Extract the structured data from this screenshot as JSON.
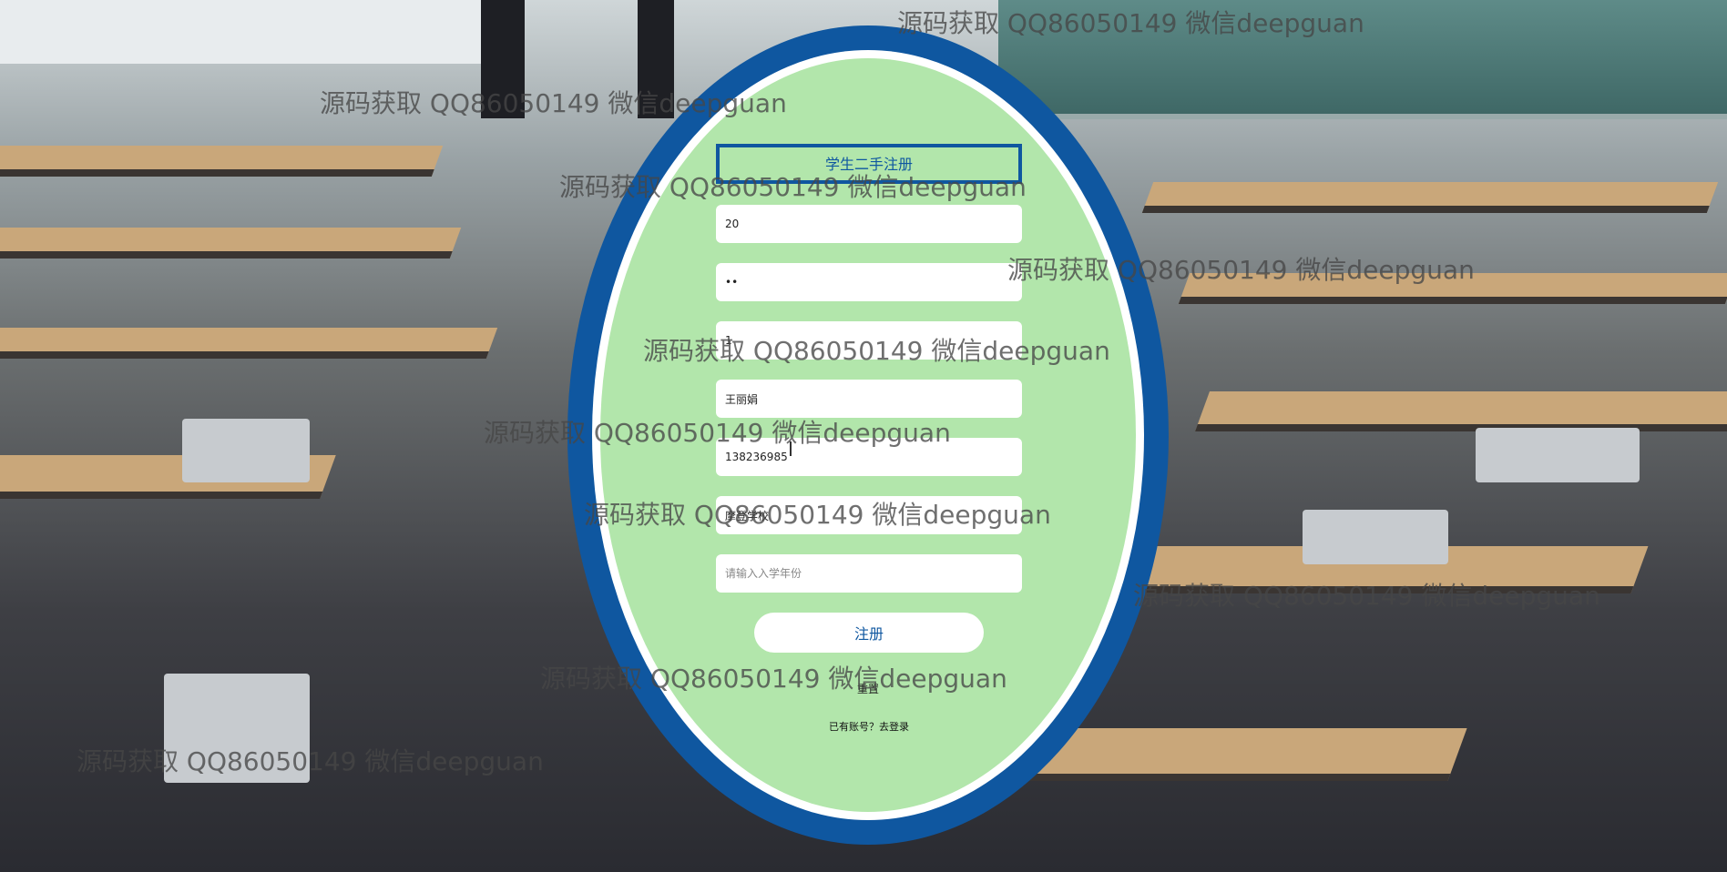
{
  "form": {
    "title": "学生二手注册",
    "fields": [
      {
        "name": "username",
        "value": "20",
        "placeholder": ""
      },
      {
        "name": "password",
        "value": "••",
        "placeholder": ""
      },
      {
        "name": "confirm",
        "value": "1",
        "placeholder": ""
      },
      {
        "name": "realname",
        "value": "王丽娟",
        "placeholder": ""
      },
      {
        "name": "phone",
        "value": "138236985",
        "placeholder": ""
      },
      {
        "name": "school",
        "value": "摩登学校",
        "placeholder": ""
      },
      {
        "name": "year",
        "value": "",
        "placeholder": "请输入入学年份"
      }
    ],
    "submit_label": "注册",
    "reset_label": "重置",
    "login_link": "已有账号？去登录"
  },
  "watermark_text": "源码获取 QQ86050149 微信deepguan",
  "colors": {
    "oval_blue": "#0f57a0",
    "oval_green": "#b2e6ab",
    "white": "#ffffff"
  }
}
